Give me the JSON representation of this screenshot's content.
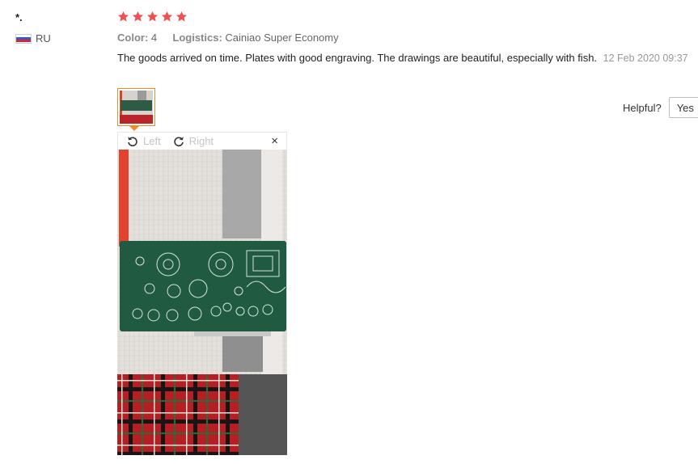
{
  "reviewer": {
    "name": "*.",
    "country_code": "RU",
    "flag_colors": [
      "#ffffff",
      "#2f5bd1",
      "#d62828"
    ]
  },
  "rating": {
    "stars": 5,
    "max": 5,
    "color": "#f0504f"
  },
  "attributes": {
    "color_label": "Color:",
    "color_value": "4",
    "logistics_label": "Logistics:",
    "logistics_value": "Cainiao Super Economy"
  },
  "review": {
    "text": "The goods arrived on time. Plates with good engraving. The drawings are beautiful, especially with fish.",
    "date": "12 Feb 2020 09:37"
  },
  "helpful": {
    "label": "Helpful?",
    "yes_label": "Yes"
  },
  "viewer": {
    "left_label": "Left",
    "right_label": "Right",
    "close_glyph": "×"
  },
  "icons": {
    "rotate_left": "rotate-left-icon",
    "rotate_right": "rotate-right-icon",
    "close": "close-icon",
    "star": "star-icon"
  },
  "accent_color": "#f28c1f"
}
